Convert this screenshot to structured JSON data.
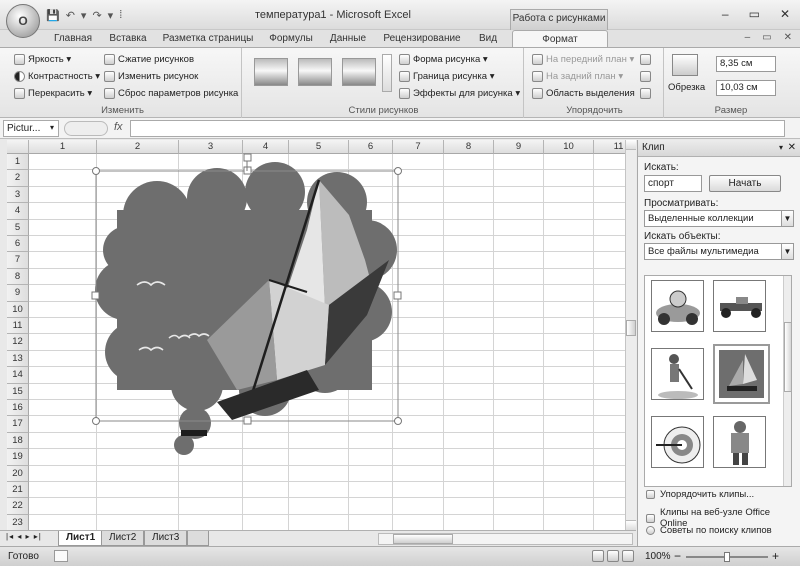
{
  "app": {
    "office_button": "O",
    "window_title": "температура1 - Microsoft Excel",
    "context_tab_title": "Работа с рисунками",
    "window_controls": [
      "–",
      "▭",
      "✕"
    ],
    "ribbon_controls": [
      "–",
      "▭",
      "✕"
    ],
    "qat": [
      "💾",
      "↶",
      "▾",
      "↷",
      "▾",
      "⁞"
    ]
  },
  "ribbon_tabs": [
    {
      "label": "Главная"
    },
    {
      "label": "Вставка"
    },
    {
      "label": "Разметка страницы"
    },
    {
      "label": "Формулы"
    },
    {
      "label": "Данные"
    },
    {
      "label": "Рецензирование"
    },
    {
      "label": "Вид"
    },
    {
      "label": "Формат"
    }
  ],
  "ribbon": {
    "izmenit": {
      "label": "Изменить",
      "brightness": "Яркость ▾",
      "contrast": "Контрастность ▾",
      "recolor": "Перекрасить ▾",
      "compress": "Сжатие рисунков",
      "change_picture": "Изменить рисунок",
      "reset": "Сброс параметров рисунка"
    },
    "styles": {
      "label": "Стили рисунков",
      "shape": "Форма рисунка ▾",
      "border": "Граница рисунка ▾",
      "effects": "Эффекты для рисунка ▾"
    },
    "arrange": {
      "label": "Упорядочить",
      "front": "На передний план ▾",
      "back": "На задний план ▾",
      "selection_pane": "Область выделения"
    },
    "size": {
      "label": "Размер",
      "crop": "Обрезка",
      "height": "8,35 см",
      "width": "10,03 см"
    }
  },
  "formula_bar": {
    "name_box": "Pictur...",
    "fx": "fx",
    "formula": ""
  },
  "grid": {
    "columns": [
      "1",
      "2",
      "3",
      "4",
      "5",
      "6",
      "7",
      "8",
      "9",
      "10",
      "11"
    ],
    "rows": [
      "1",
      "2",
      "3",
      "4",
      "5",
      "6",
      "7",
      "8",
      "9",
      "10",
      "11",
      "12",
      "13",
      "14",
      "15",
      "16",
      "17",
      "18",
      "19",
      "20",
      "21",
      "22",
      "23"
    ]
  },
  "sheets": {
    "nav": "|◂ ◂ ▸ ▸|",
    "tabs": [
      "Лист1",
      "Лист2",
      "Лист3"
    ],
    "active_index": 0
  },
  "status_bar": {
    "ready": "Готово",
    "zoom": "100%",
    "zoom_minus": "−",
    "zoom_plus": "+"
  },
  "clip_pane": {
    "title": "Клип",
    "search_label": "Искать:",
    "search_value": "спорт",
    "go_button": "Начать",
    "browse_label": "Просматривать:",
    "browse_value": "Выделенные коллекции",
    "type_label": "Искать объекты:",
    "type_value": "Все файлы мультимедиа",
    "link_organize": "Упорядочить клипы...",
    "link_online": "Клипы на веб-узле Office Online",
    "link_tips": "Советы по поиску клипов"
  },
  "colors": {
    "cloud": "#6e6e6e",
    "selection": "#8a8a8a"
  }
}
